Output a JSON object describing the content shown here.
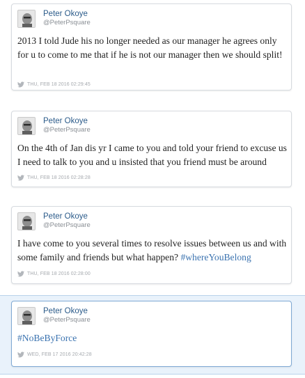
{
  "tweets": [
    {
      "name": "Peter Okoye",
      "handle": "@PeterPsquare",
      "text": "2013 I told Jude his no longer needed as our manager he agrees only for u to come to me that if he is not our manager then we should split!",
      "hashtag": "",
      "timestamp": "THU, FEB 18 2016 02:29:45"
    },
    {
      "name": "Peter Okoye",
      "handle": "@PeterPsquare",
      "text": "On the 4th of Jan dis yr I came to you and told your friend to excuse us I need to talk to you and u insisted that you friend must be around",
      "hashtag": "",
      "timestamp": "THU, FEB 18 2016 02:28:28"
    },
    {
      "name": "Peter Okoye",
      "handle": "@PeterPsquare",
      "text": "I have come to you several times to resolve issues between us and with some family and friends but what happen? ",
      "hashtag": "#whereYouBelong",
      "timestamp": "THU, FEB 18 2016 02:28:00"
    },
    {
      "name": "Peter Okoye",
      "handle": "@PeterPsquare",
      "text": "",
      "hashtag": "#NoBeByForce",
      "timestamp": "WED, FEB 17 2016 20:42:28"
    }
  ],
  "icons": {
    "avatar": "avatar-photo",
    "meta": "twitter-bird-icon"
  },
  "colors": {
    "name": "#2b5b8a",
    "hashtag": "#3b73b0",
    "highlight_band": "#e9f2fb"
  }
}
